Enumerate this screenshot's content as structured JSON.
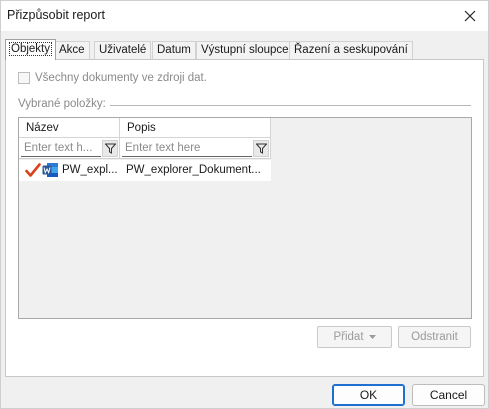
{
  "window": {
    "title": "Přizpůsobit report"
  },
  "tabs": [
    {
      "label": "Objekty",
      "active": true
    },
    {
      "label": "Akce",
      "active": false
    },
    {
      "label": "Uživatelé",
      "active": false
    },
    {
      "label": "Datum",
      "active": false
    },
    {
      "label": "Výstupní sloupce",
      "active": false
    },
    {
      "label": "Řazení a seskupování",
      "active": false
    }
  ],
  "objects_tab": {
    "all_docs_checkbox": {
      "label": "Všechny dokumenty ve zdroji dat.",
      "checked": false,
      "enabled": false
    },
    "selected_items_label": "Vybrané položky:",
    "grid": {
      "columns": [
        {
          "label": "Název"
        },
        {
          "label": "Popis"
        }
      ],
      "filters": [
        {
          "placeholder": "Enter text h..."
        },
        {
          "placeholder": "Enter text here"
        }
      ],
      "rows": [
        {
          "name": "PW_expl...",
          "description": "PW_explorer_Dokument...",
          "icon": "word-document-icon",
          "checked": true
        }
      ]
    },
    "add_button": {
      "label": "Přidat"
    },
    "remove_button": {
      "label": "Odstranit"
    }
  },
  "footer": {
    "ok_label": "OK",
    "cancel_label": "Cancel"
  },
  "colors": {
    "accent": "#1e6fd0",
    "check_mark": "#d9421c",
    "word_blue": "#2b579a"
  }
}
